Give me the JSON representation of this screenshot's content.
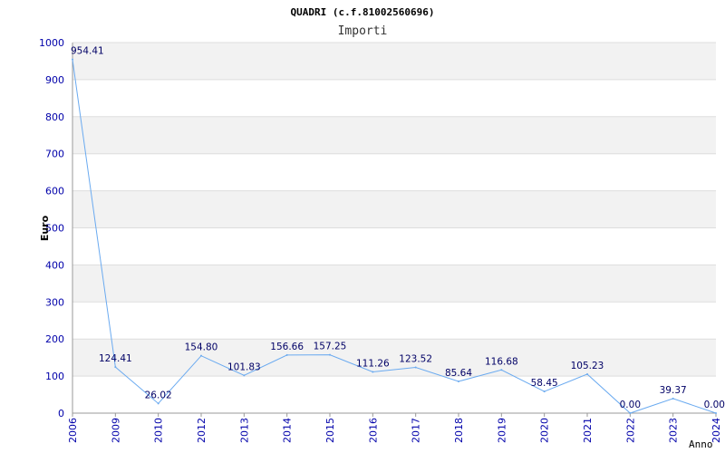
{
  "chart_data": {
    "type": "line",
    "title": "QUADRI (c.f.81002560696)",
    "subtitle": "Importi",
    "xlabel": "Anno",
    "ylabel": "Euro",
    "ylim": [
      0,
      1000
    ],
    "yticks": [
      "0",
      "100",
      "200",
      "300",
      "400",
      "500",
      "600",
      "700",
      "800",
      "900",
      "1000"
    ],
    "grid": true,
    "categories": [
      "2006",
      "2009",
      "2010",
      "2012",
      "2013",
      "2014",
      "2015",
      "2016",
      "2017",
      "2018",
      "2019",
      "2020",
      "2021",
      "2022",
      "2023",
      "2024"
    ],
    "values": [
      954.41,
      124.41,
      26.02,
      154.8,
      101.83,
      156.66,
      157.25,
      111.26,
      123.52,
      85.64,
      116.68,
      58.45,
      105.23,
      0.0,
      39.37,
      0.0
    ],
    "value_labels": [
      "954.41",
      "124.41",
      "26.02",
      "154.80",
      "101.83",
      "156.66",
      "157.25",
      "111.26",
      "123.52",
      "85.64",
      "116.68",
      "58.45",
      "105.23",
      "0.00",
      "39.37",
      "0.00"
    ],
    "line_color": "#6aaaf0",
    "band_color": "#f2f2f2",
    "tick_color": "#0000aa"
  }
}
